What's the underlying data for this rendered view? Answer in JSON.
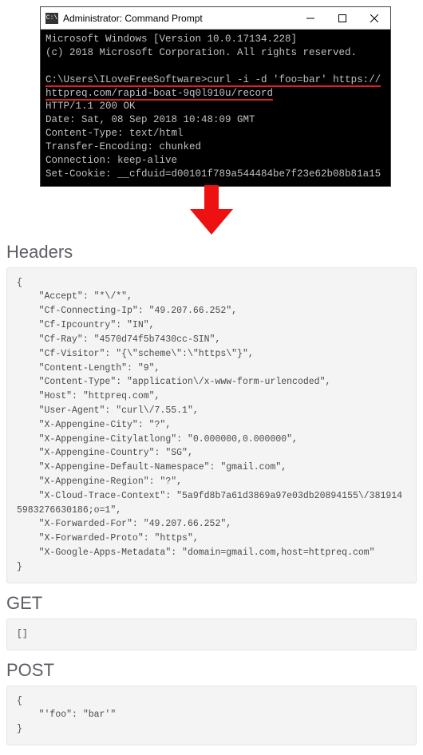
{
  "cmd": {
    "title": "Administrator: Command Prompt",
    "icon_text": "C:\\",
    "line1": "Microsoft Windows [Version 10.0.17134.228]",
    "line2": "(c) 2018 Microsoft Corporation. All rights reserved.",
    "prompt": "C:\\Users\\ILoveFreeSoftware>",
    "cmd_part1": "curl -i -d 'foo=bar' https://",
    "cmd_part2": "httpreq.com/rapid-boat-9q0l910u/record",
    "resp": {
      "status": "HTTP/1.1 200 OK",
      "date": "Date: Sat, 08 Sep 2018 10:48:09 GMT",
      "ctype": "Content-Type: text/html",
      "tenc": "Transfer-Encoding: chunked",
      "conn": "Connection: keep-alive",
      "cookie": "Set-Cookie: __cfduid=d00101f789a544484be7f23e62b08b81a15"
    }
  },
  "sections": {
    "headers_title": "Headers",
    "get_title": "GET",
    "post_title": "POST"
  },
  "headers_json": {
    "Accept": "*\\/*",
    "Cf-Connecting-Ip": "49.207.66.252",
    "Cf-Ipcountry": "IN",
    "Cf-Ray": "4570d74f5b7430cc-SIN",
    "Cf-Visitor": "{\\\"scheme\\\":\\\"https\\\"}",
    "Content-Length": "9",
    "Content-Type": "application\\/x-www-form-urlencoded",
    "Host": "httpreq.com",
    "User-Agent": "curl\\/7.55.1",
    "X-Appengine-City": "?",
    "X-Appengine-Citylatlong": "0.000000,0.000000",
    "X-Appengine-Country": "SG",
    "X-Appengine-Default-Namespace": "gmail.com",
    "X-Appengine-Region": "?",
    "X-Cloud-Trace-Context": "5a9fd8b7a61d3869a97e03db20894155\\/3819145983276630186;o=1",
    "X-Forwarded-For": "49.207.66.252",
    "X-Forwarded-Proto": "https",
    "X-Google-Apps-Metadata": "domain=gmail.com,host=httpreq.com"
  },
  "get_body": "[]",
  "post_json": {
    "'foo": "bar'"
  }
}
